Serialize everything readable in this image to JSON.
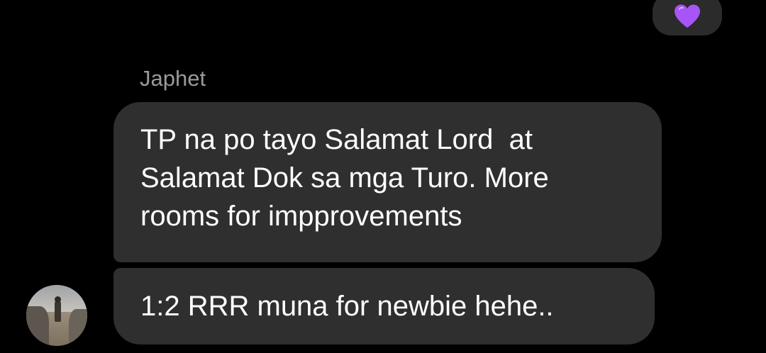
{
  "reaction": {
    "icon": "purple-heart-icon",
    "color": "#a855f7"
  },
  "sender": {
    "name": "Japhet"
  },
  "messages": [
    {
      "lines": [
        "TP na po tayo Salamat Lord  at",
        "Salamat Dok sa mga Turo. More",
        "rooms for impprovements"
      ]
    },
    {
      "lines": [
        "1:2 RRR muna for newbie hehe.."
      ]
    }
  ],
  "colors": {
    "background": "#000000",
    "bubble": "#2f2f2f",
    "reaction_bubble": "#2b2b2b",
    "sender_name": "#9a9a9a",
    "text": "#ffffff"
  }
}
